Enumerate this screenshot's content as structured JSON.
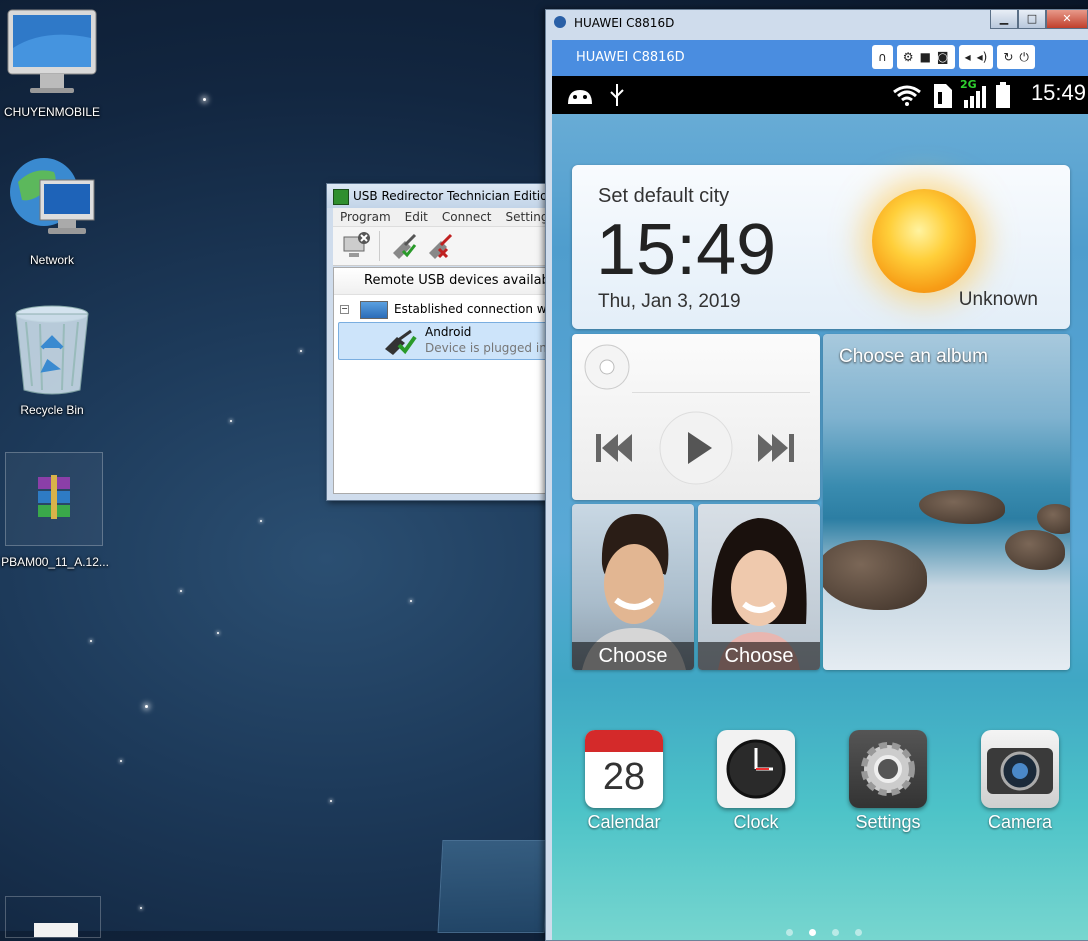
{
  "desktop": {
    "icons": [
      {
        "label": "CHUYENMOBILE",
        "icon": "imac-computer-icon"
      },
      {
        "label": "Network",
        "icon": "network-globe-icon"
      },
      {
        "label": "Recycle Bin",
        "icon": "recycle-bin-icon"
      },
      {
        "label": "PBAM00_11_A.12...",
        "icon": "winrar-archive-icon"
      }
    ]
  },
  "usb_window": {
    "title": "USB Redirector Technician Edition -",
    "menu": [
      "Program",
      "Edit",
      "Connect",
      "Settings"
    ],
    "header": "Remote USB devices availab",
    "connection": "Established connection with",
    "device": {
      "name": "Android",
      "status": "Device is plugged into"
    }
  },
  "phone_window": {
    "title": "HUAWEI C8816D",
    "header": "HUAWEI C8816D",
    "window_buttons": [
      "minimize-icon",
      "maximize-icon",
      "close-icon"
    ],
    "controls": [
      "headset-icon",
      "gear-icon",
      "video-icon",
      "camera-icon",
      "volume-down-icon",
      "volume-up-icon",
      "rotate-icon",
      "power-icon"
    ]
  },
  "phone": {
    "status": {
      "time": "15:49",
      "network": "2G"
    },
    "weather": {
      "city": "Set default city",
      "time": "15:49",
      "date": "Thu, Jan 3, 2019",
      "condition": "Unknown"
    },
    "album": {
      "label": "Choose an album"
    },
    "contacts": [
      {
        "label": "Choose"
      },
      {
        "label": "Choose"
      }
    ],
    "apps": [
      {
        "label": "Calendar",
        "badge": "28"
      },
      {
        "label": "Clock"
      },
      {
        "label": "Settings"
      },
      {
        "label": "Camera"
      }
    ],
    "page_dots": {
      "count": 4,
      "active": 2
    }
  },
  "colors": {
    "phone_header": "#4a8de0",
    "window_frame": "#cfdcec"
  }
}
